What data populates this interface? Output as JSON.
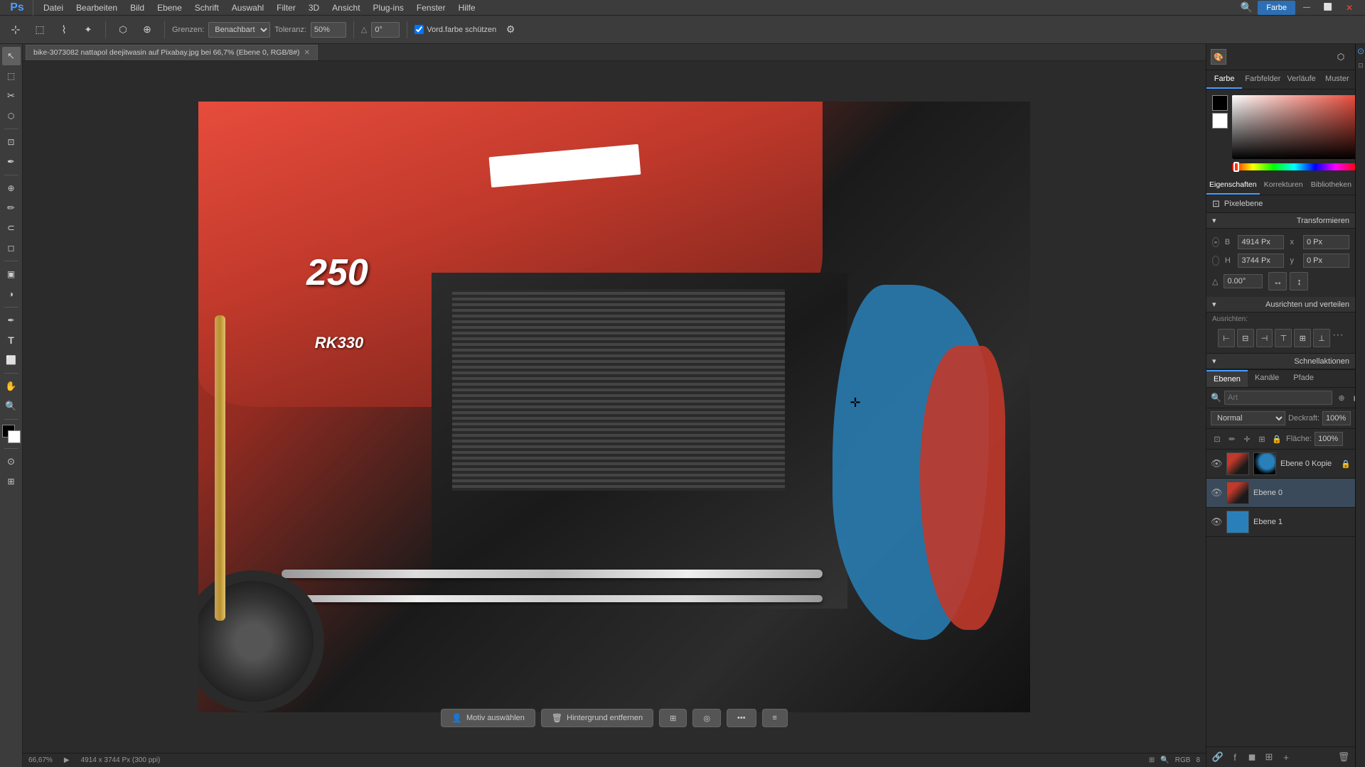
{
  "app": {
    "title": "Adobe Photoshop"
  },
  "menu": {
    "items": [
      "Datei",
      "Bearbeiten",
      "Bild",
      "Ebene",
      "Schrift",
      "Auswahl",
      "Filter",
      "3D",
      "Ansicht",
      "Plug-ins",
      "Fenster",
      "Hilfe"
    ]
  },
  "toolbar": {
    "grenzen_label": "Grenzen:",
    "grenzen_value": "Benachbart",
    "toleranz_label": "Toleranz:",
    "toleranz_value": "50%",
    "angle_value": "0°",
    "vord_label": "Vord.farbe schützen",
    "tab_title": "bike-3073082 nattapol deejitwasin auf Pixabay.jpg bei 66,7% (Ebene 0, RGB/8#)"
  },
  "right_panel": {
    "top_tabs": [
      "Farbe",
      "Farbfelder",
      "Verläufe",
      "Muster"
    ],
    "properties_tabs": [
      "Eigenschaften",
      "Korrekturen",
      "Bibliotheken"
    ],
    "pixel_ebene_label": "Pixelebene",
    "transform_section": "Transformieren",
    "transform": {
      "b_label": "B",
      "b_value": "4914 Px",
      "x_label": "x",
      "x_value": "0 Px",
      "h_label": "H",
      "h_value": "3744 Px",
      "y_label": "y",
      "y_value": "0 Px",
      "angle_value": "0.00°"
    },
    "ausrichten_section": "Ausrichten und verteilen",
    "ausrichten_label": "Ausrichten:",
    "schnell_section": "Schnellaktionen",
    "layers_section": {
      "tabs": [
        "Ebenen",
        "Kanäle",
        "Pfade"
      ],
      "search_placeholder": "Art",
      "mode_value": "Normal",
      "deckraft_label": "Deckraft:",
      "deckraft_value": "100%",
      "flache_label": "Fläche:",
      "flache_value": "100%",
      "layers": [
        {
          "name": "Ebene 0 Kopie",
          "visible": true,
          "type": "copy"
        },
        {
          "name": "Ebene 0",
          "visible": true,
          "type": "original"
        },
        {
          "name": "Ebene 1",
          "visible": true,
          "type": "blue"
        }
      ]
    }
  },
  "status_bar": {
    "zoom": "66,67%",
    "dimensions": "4914 x 3744 Px (300 ppi)"
  },
  "bottom_tools": {
    "motiv_btn": "Motiv auswählen",
    "hintergrund_btn": "Hintergrund entfernen"
  },
  "tools": {
    "items": [
      "↖",
      "⬚",
      "✂",
      "✏",
      "🔨",
      "✒",
      "T",
      "⬜",
      "🔍",
      "🖐",
      "⬡"
    ]
  }
}
